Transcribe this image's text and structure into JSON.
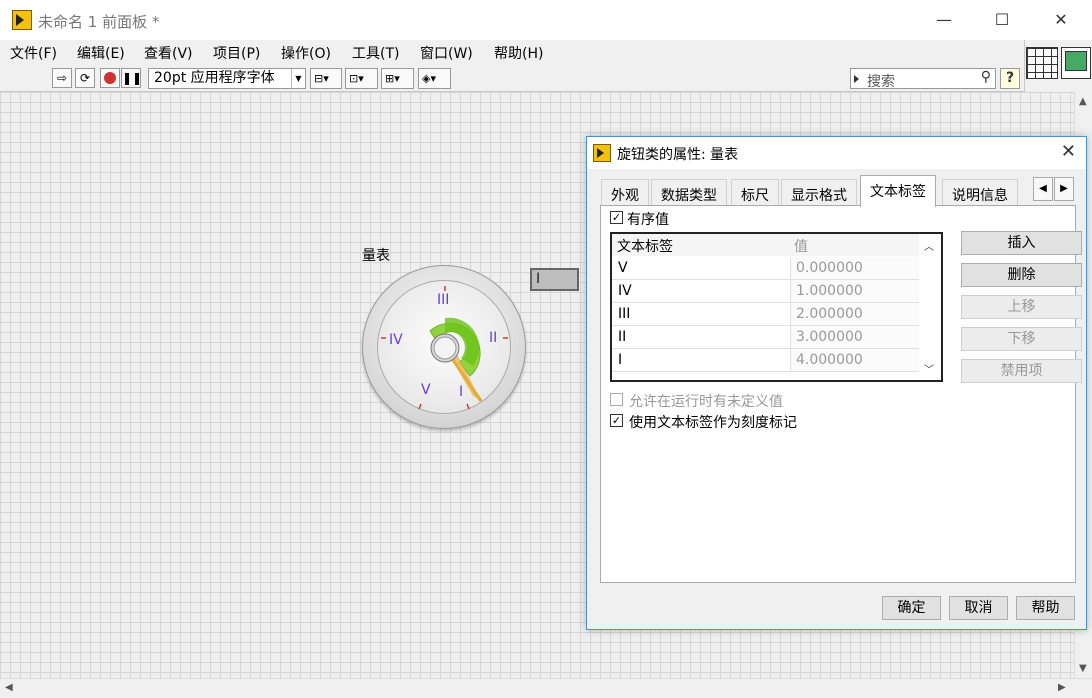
{
  "window": {
    "title": "未命名 1 前面板 *",
    "minimize": "—",
    "maximize": "☐",
    "close": "✕"
  },
  "menubar": [
    "文件(F)",
    "编辑(E)",
    "查看(V)",
    "项目(P)",
    "操作(O)",
    "工具(T)",
    "窗口(W)",
    "帮助(H)"
  ],
  "toolbar": {
    "font": "20pt 应用程序字体",
    "search_placeholder": "搜索",
    "help": "?"
  },
  "meter": {
    "label": "量表",
    "ticks": [
      "V",
      "IV",
      "III",
      "II",
      "I"
    ],
    "value_index": 4,
    "ring_value": "I",
    "colors": {
      "tick_text": "#6b3fd6",
      "arc": "#7ccf2a",
      "needle": "#e0a020"
    }
  },
  "dialog": {
    "title": "旋钮类的属性: 量表",
    "close": "✕",
    "tabs": [
      "外观",
      "数据类型",
      "标尺",
      "显示格式",
      "文本标签",
      "说明信息"
    ],
    "active_tab": "文本标签",
    "ordered_values_label": "有序值",
    "ordered_values_checked": true,
    "table": {
      "headers": [
        "文本标签",
        "值"
      ],
      "rows": [
        {
          "label": "V",
          "value": "0.000000"
        },
        {
          "label": "IV",
          "value": "1.000000"
        },
        {
          "label": "III",
          "value": "2.000000"
        },
        {
          "label": "II",
          "value": "3.000000"
        },
        {
          "label": "I",
          "value": "4.000000"
        }
      ]
    },
    "side_buttons": {
      "insert": "插入",
      "delete": "删除",
      "move_up": "上移",
      "move_down": "下移",
      "disable": "禁用项"
    },
    "allow_undefined_label": "允许在运行时有未定义值",
    "use_text_labels_label": "使用文本标签作为刻度标记",
    "footer": {
      "ok": "确定",
      "cancel": "取消",
      "help": "帮助"
    }
  }
}
